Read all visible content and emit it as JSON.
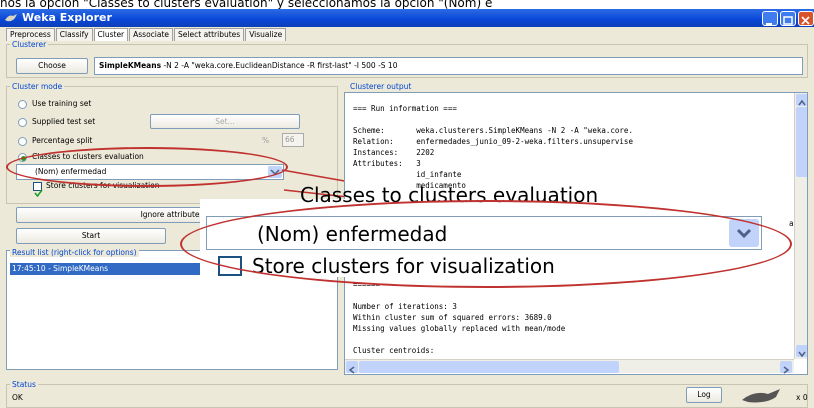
{
  "caption": "nos la opción \"Classes to clusters evaluation\" y seleccionamos la opción \"(Nom) e",
  "window": {
    "title": "Weka Explorer"
  },
  "tabs": [
    "Preprocess",
    "Classify",
    "Cluster",
    "Associate",
    "Select attributes",
    "Visualize"
  ],
  "clusterer": {
    "group_label": "Clusterer",
    "choose_label": "Choose",
    "algorithm": "SimpleKMeans",
    "options": "-N 2 -A \"weka.core.EuclideanDistance -R first-last\" -I 500 -S 10"
  },
  "cluster_mode": {
    "group_label": "Cluster mode",
    "use_training": "Use training set",
    "supplied_test": "Supplied test set",
    "set_label": "Set...",
    "percentage_split": "Percentage split",
    "percent_symbol": "%",
    "percent_value": "66",
    "classes_to_clusters": "Classes to clusters evaluation",
    "selected_attribute": "(Nom) enfermedad",
    "store_clusters": "Store clusters for visualization",
    "selected_mode": "classes_to_clusters"
  },
  "ignore_button": "Ignore attributes",
  "start_button": "Start",
  "result_list": {
    "label": "Result list (right-click for options)",
    "items": [
      "17:45:10 - SimpleKMeans"
    ]
  },
  "output": {
    "label": "Clusterer output",
    "lines_top": [
      "=== Run information ===",
      "",
      "Scheme:       weka.clusterers.SimpleKMeans -N 2 -A \"weka.core.",
      "Relation:     enfermedades_junio_09-2-weka.filters.unsupervise",
      "Instances:    2202",
      "Attributes:   3",
      "              id_infante",
      "              medicamento"
    ],
    "lines_bottom": [
      "======",
      "",
      "Number of iterations: 3",
      "Within cluster sum of squared errors: 3689.0",
      "Missing values globally replaced with mean/mode",
      "",
      "Cluster centroids:"
    ],
    "side_fragment": "a"
  },
  "zoom": {
    "heading": "Classes to clusters evaluation",
    "selected": "(Nom) enfermedad",
    "store": "Store clusters for visualization"
  },
  "status": {
    "label": "Status",
    "text": "OK",
    "log_button": "Log",
    "count": "x 0"
  },
  "colors": {
    "title_bar": "#0a46d6",
    "group_label": "#0046d5",
    "selection": "#316ac5",
    "highlight": "#c0322f",
    "window_bg": "#ece9d8"
  }
}
